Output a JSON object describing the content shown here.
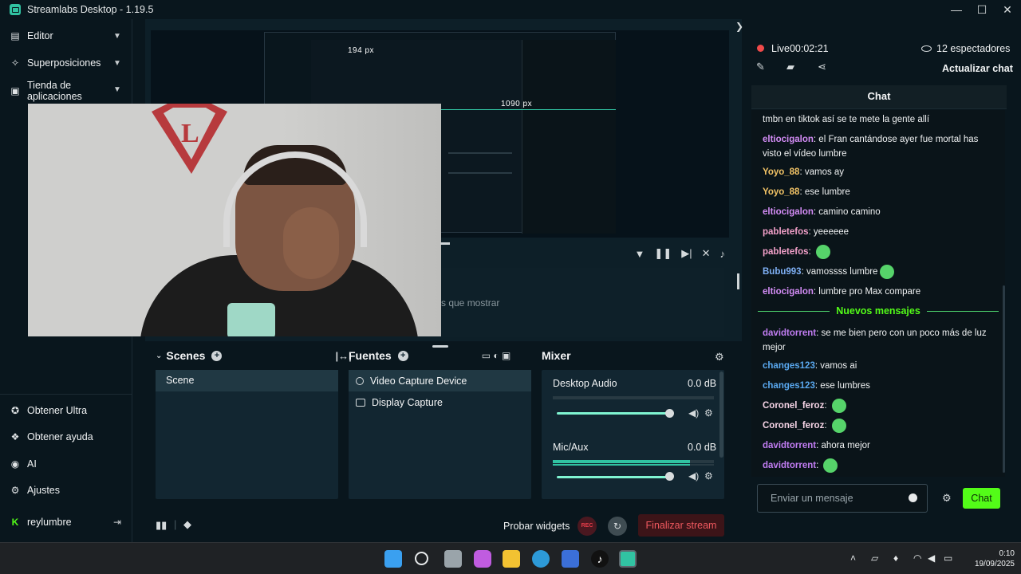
{
  "window": {
    "title": "Streamlabs Desktop - 1.19.5",
    "minimize": "—",
    "maximize": "☐",
    "close": "✕"
  },
  "sidebar": {
    "items": [
      {
        "label": "Editor"
      },
      {
        "label": "Superposiciones"
      },
      {
        "label": "Tienda de aplicaciones"
      }
    ],
    "bottom": [
      {
        "label": "Obtener Ultra"
      },
      {
        "label": "Obtener ayuda"
      },
      {
        "label": "AI"
      },
      {
        "label": "Ajustes"
      },
      {
        "label": "reylumbre"
      }
    ]
  },
  "preview": {
    "width_label": "194 px",
    "height_label": "1090 px"
  },
  "logs": {
    "empty_text": "s que mostrar"
  },
  "scenes": {
    "title": "Scenes",
    "items": [
      "Scene"
    ]
  },
  "sources": {
    "title": "Fuentes",
    "items": [
      "Video Capture Device",
      "Display Capture"
    ]
  },
  "mixer": {
    "title": "Mixer",
    "channels": [
      {
        "name": "Desktop Audio",
        "db": "0.0 dB",
        "level": 0.0,
        "volume": 1.0
      },
      {
        "name": "Mic/Aux",
        "db": "0.0 dB",
        "level": 0.85,
        "volume": 1.0
      }
    ]
  },
  "footer": {
    "test_widgets": "Probar widgets",
    "rec": "REC",
    "end_stream": "Finalizar stream"
  },
  "stream": {
    "live": "Live",
    "timer": "00:02:21",
    "viewers": "12 espectadores",
    "refresh_chat": "Actualizar chat"
  },
  "chat": {
    "title": "Chat",
    "new_messages": "Nuevos mensajes",
    "messages": [
      {
        "user": "",
        "text": "tmbn en tiktok así se te mete la gente allí",
        "color": "#f0f2f3"
      },
      {
        "user": "eltiocigalon",
        "text": "el Fran cantándose ayer fue mortal has visto el vídeo lumbre",
        "color": "#d38cf5"
      },
      {
        "user": "Yoyo_88",
        "text": "vamos ay",
        "color": "#f2c366"
      },
      {
        "user": "Yoyo_88",
        "text": "ese lumbre",
        "color": "#f2c366"
      },
      {
        "user": "eltiocigalon",
        "text": "camino camino",
        "color": "#d38cf5"
      },
      {
        "user": "pabletefos",
        "text": "yeeeeee",
        "color": "#f2a0c9"
      },
      {
        "user": "pabletefos",
        "text": "",
        "color": "#f2a0c9"
      },
      {
        "user": "Bubu993",
        "text": "vamossss lumbre",
        "color": "#7fb0f5"
      },
      {
        "user": "eltiocigalon",
        "text": "lumbre pro Max compare",
        "color": "#d38cf5"
      },
      {
        "user": "davidtorrent",
        "text": "se me bien pero con un poco más de luz mejor",
        "color": "#c17df2"
      },
      {
        "user": "changes123",
        "text": "vamos ai",
        "color": "#5aa9f0"
      },
      {
        "user": "changes123",
        "text": "ese lumbres",
        "color": "#5aa9f0"
      },
      {
        "user": "Coronel_feroz",
        "text": "",
        "color": "#f5d3e5"
      },
      {
        "user": "Coronel_feroz",
        "text": "",
        "color": "#f5d3e5"
      },
      {
        "user": "davidtorrent",
        "text": "ahora mejor",
        "color": "#c17df2"
      },
      {
        "user": "davidtorrent",
        "text": "",
        "color": "#c17df2"
      }
    ],
    "input_placeholder": "Enviar un mensaje",
    "send": "Chat"
  },
  "taskbar": {
    "time": "0:10",
    "date": "19/09/2025"
  }
}
